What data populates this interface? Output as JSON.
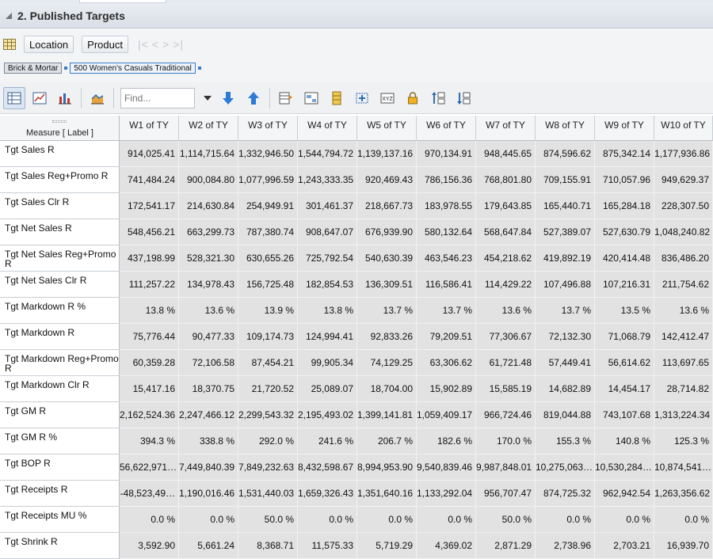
{
  "panel": {
    "title": "2. Published Targets"
  },
  "dimensions": {
    "location_label": "Location",
    "product_label": "Product"
  },
  "breadcrumbs": [
    "Brick & Mortar",
    "500 Women's Casuals Traditional"
  ],
  "toolbar": {
    "find_placeholder": "Find..."
  },
  "grid": {
    "corner_label": "Measure [ Label ]",
    "columns": [
      "W1 of TY",
      "W2 of TY",
      "W3 of TY",
      "W4 of TY",
      "W5 of TY",
      "W6 of TY",
      "W7 of TY",
      "W8 of TY",
      "W9 of TY",
      "W10 of TY"
    ],
    "rows": [
      {
        "label": "Tgt Sales R",
        "values": [
          "914,025.41",
          "1,114,715.64",
          "1,332,946.50",
          "1,544,794.72",
          "1,139,137.16",
          "970,134.91",
          "948,445.65",
          "874,596.62",
          "875,342.14",
          "1,177,936.86"
        ]
      },
      {
        "label": "Tgt Sales Reg+Promo R",
        "values": [
          "741,484.24",
          "900,084.80",
          "1,077,996.59",
          "1,243,333.35",
          "920,469.43",
          "786,156.36",
          "768,801.80",
          "709,155.91",
          "710,057.96",
          "949,629.37"
        ]
      },
      {
        "label": "Tgt Sales Clr R",
        "values": [
          "172,541.17",
          "214,630.84",
          "254,949.91",
          "301,461.37",
          "218,667.73",
          "183,978.55",
          "179,643.85",
          "165,440.71",
          "165,284.18",
          "228,307.50"
        ]
      },
      {
        "label": "Tgt Net Sales R",
        "values": [
          "548,456.21",
          "663,299.73",
          "787,380.74",
          "908,647.07",
          "676,939.90",
          "580,132.64",
          "568,647.84",
          "527,389.07",
          "527,630.79",
          "1,048,240.82"
        ]
      },
      {
        "label": "Tgt Net Sales Reg+Promo R",
        "values": [
          "437,198.99",
          "528,321.30",
          "630,655.26",
          "725,792.54",
          "540,630.39",
          "463,546.23",
          "454,218.62",
          "419,892.19",
          "420,414.48",
          "836,486.20"
        ]
      },
      {
        "label": "Tgt Net Sales Clr R",
        "values": [
          "111,257.22",
          "134,978.43",
          "156,725.48",
          "182,854.53",
          "136,309.51",
          "116,586.41",
          "114,429.22",
          "107,496.88",
          "107,216.31",
          "211,754.62"
        ]
      },
      {
        "label": "Tgt Markdown R %",
        "values": [
          "13.8 %",
          "13.6 %",
          "13.9 %",
          "13.8 %",
          "13.7 %",
          "13.7 %",
          "13.6 %",
          "13.7 %",
          "13.5 %",
          "13.6 %"
        ]
      },
      {
        "label": "Tgt Markdown R",
        "values": [
          "75,776.44",
          "90,477.33",
          "109,174.73",
          "124,994.41",
          "92,833.26",
          "79,209.51",
          "77,306.67",
          "72,132.30",
          "71,068.79",
          "142,412.47"
        ]
      },
      {
        "label": "Tgt Markdown Reg+Promo R",
        "values": [
          "60,359.28",
          "72,106.58",
          "87,454.21",
          "99,905.34",
          "74,129.25",
          "63,306.62",
          "61,721.48",
          "57,449.41",
          "56,614.62",
          "113,697.65"
        ]
      },
      {
        "label": "Tgt Markdown Clr R",
        "values": [
          "15,417.16",
          "18,370.75",
          "21,720.52",
          "25,089.07",
          "18,704.00",
          "15,902.89",
          "15,585.19",
          "14,682.89",
          "14,454.17",
          "28,714.82"
        ]
      },
      {
        "label": "Tgt GM R",
        "values": [
          "2,162,524.36",
          "2,247,466.12",
          "2,299,543.32",
          "2,195,493.02",
          "1,399,141.81",
          "1,059,409.17",
          "966,724.46",
          "819,044.88",
          "743,107.68",
          "1,313,224.34"
        ]
      },
      {
        "label": "Tgt GM R %",
        "values": [
          "394.3 %",
          "338.8 %",
          "292.0 %",
          "241.6 %",
          "206.7 %",
          "182.6 %",
          "170.0 %",
          "155.3 %",
          "140.8 %",
          "125.3 %"
        ]
      },
      {
        "label": "Tgt BOP R",
        "values": [
          "56,622,971…",
          "7,449,840.39",
          "7,849,232.63",
          "8,432,598.67",
          "8,994,953.90",
          "9,540,839.46",
          "9,987,848.01",
          "10,275,063…",
          "10,530,284…",
          "10,874,541…"
        ]
      },
      {
        "label": "Tgt Receipts R",
        "values": [
          "-48,523,49…",
          "1,190,016.46",
          "1,531,440.03",
          "1,659,326.43",
          "1,351,640.16",
          "1,133,292.04",
          "956,707.47",
          "874,725.32",
          "962,942.54",
          "1,263,356.62"
        ]
      },
      {
        "label": "Tgt Receipts MU %",
        "values": [
          "0.0 %",
          "0.0 %",
          "50.0 %",
          "0.0 %",
          "0.0 %",
          "0.0 %",
          "50.0 %",
          "0.0 %",
          "0.0 %",
          "0.0 %"
        ]
      },
      {
        "label": "Tgt Shrink R",
        "values": [
          "3,592.90",
          "5,661.24",
          "8,368.71",
          "11,575.33",
          "5,719.29",
          "4,369.02",
          "2,871.29",
          "2,738.96",
          "2,703.21",
          "16,939.70"
        ]
      }
    ]
  },
  "colors": {
    "cell_bg": "#e2e2e2",
    "accent": "#3a78c9",
    "header_bg": "#f4f5f6"
  }
}
